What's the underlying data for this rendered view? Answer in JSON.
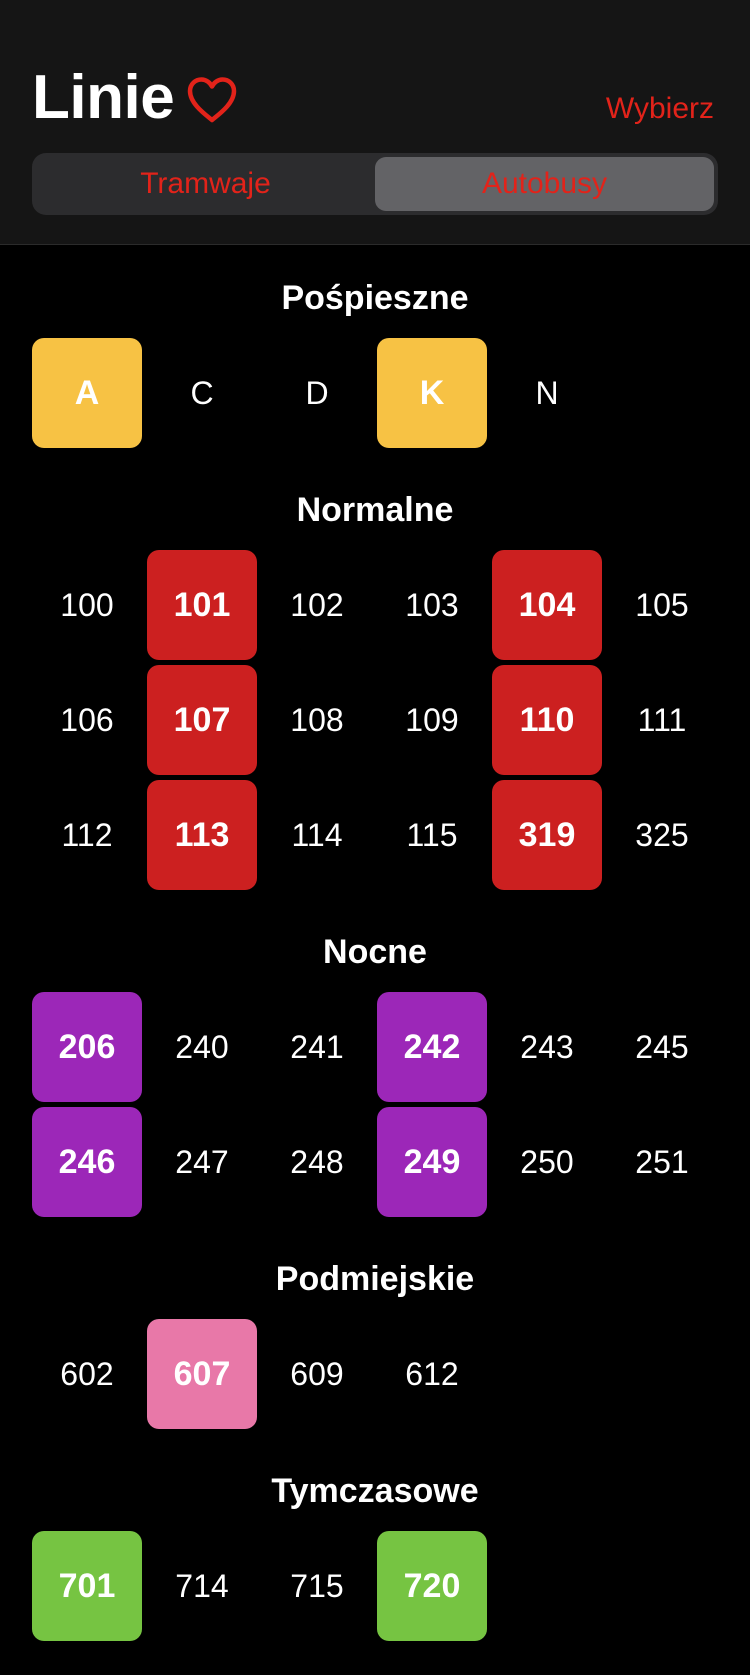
{
  "header": {
    "title": "Linie",
    "select_label": "Wybierz",
    "tabs": [
      {
        "label": "Tramwaje",
        "active": false
      },
      {
        "label": "Autobusy",
        "active": true
      }
    ]
  },
  "colors": {
    "accent": "#e2231a",
    "express": "#f7c244",
    "normal": "#cc2020",
    "night": "#9c27b8",
    "suburban": "#e878a8",
    "temporary": "#76c442"
  },
  "sections": [
    {
      "title": "Pośpieszne",
      "color_key": "express",
      "lines": [
        {
          "label": "A",
          "favorite": true
        },
        {
          "label": "C",
          "favorite": false
        },
        {
          "label": "D",
          "favorite": false
        },
        {
          "label": "K",
          "favorite": true
        },
        {
          "label": "N",
          "favorite": false
        }
      ]
    },
    {
      "title": "Normalne",
      "color_key": "normal",
      "lines": [
        {
          "label": "100",
          "favorite": false
        },
        {
          "label": "101",
          "favorite": true
        },
        {
          "label": "102",
          "favorite": false
        },
        {
          "label": "103",
          "favorite": false
        },
        {
          "label": "104",
          "favorite": true
        },
        {
          "label": "105",
          "favorite": false
        },
        {
          "label": "106",
          "favorite": false
        },
        {
          "label": "107",
          "favorite": true
        },
        {
          "label": "108",
          "favorite": false
        },
        {
          "label": "109",
          "favorite": false
        },
        {
          "label": "110",
          "favorite": true
        },
        {
          "label": "111",
          "favorite": false
        },
        {
          "label": "112",
          "favorite": false
        },
        {
          "label": "113",
          "favorite": true
        },
        {
          "label": "114",
          "favorite": false
        },
        {
          "label": "115",
          "favorite": false
        },
        {
          "label": "319",
          "favorite": true
        },
        {
          "label": "325",
          "favorite": false
        }
      ]
    },
    {
      "title": "Nocne",
      "color_key": "night",
      "lines": [
        {
          "label": "206",
          "favorite": true
        },
        {
          "label": "240",
          "favorite": false
        },
        {
          "label": "241",
          "favorite": false
        },
        {
          "label": "242",
          "favorite": true
        },
        {
          "label": "243",
          "favorite": false
        },
        {
          "label": "245",
          "favorite": false
        },
        {
          "label": "246",
          "favorite": true
        },
        {
          "label": "247",
          "favorite": false
        },
        {
          "label": "248",
          "favorite": false
        },
        {
          "label": "249",
          "favorite": true
        },
        {
          "label": "250",
          "favorite": false
        },
        {
          "label": "251",
          "favorite": false
        }
      ]
    },
    {
      "title": "Podmiejskie",
      "color_key": "suburban",
      "lines": [
        {
          "label": "602",
          "favorite": false
        },
        {
          "label": "607",
          "favorite": true
        },
        {
          "label": "609",
          "favorite": false
        },
        {
          "label": "612",
          "favorite": false
        }
      ]
    },
    {
      "title": "Tymczasowe",
      "color_key": "temporary",
      "lines": [
        {
          "label": "701",
          "favorite": true
        },
        {
          "label": "714",
          "favorite": false
        },
        {
          "label": "715",
          "favorite": false
        },
        {
          "label": "720",
          "favorite": true
        }
      ]
    }
  ]
}
